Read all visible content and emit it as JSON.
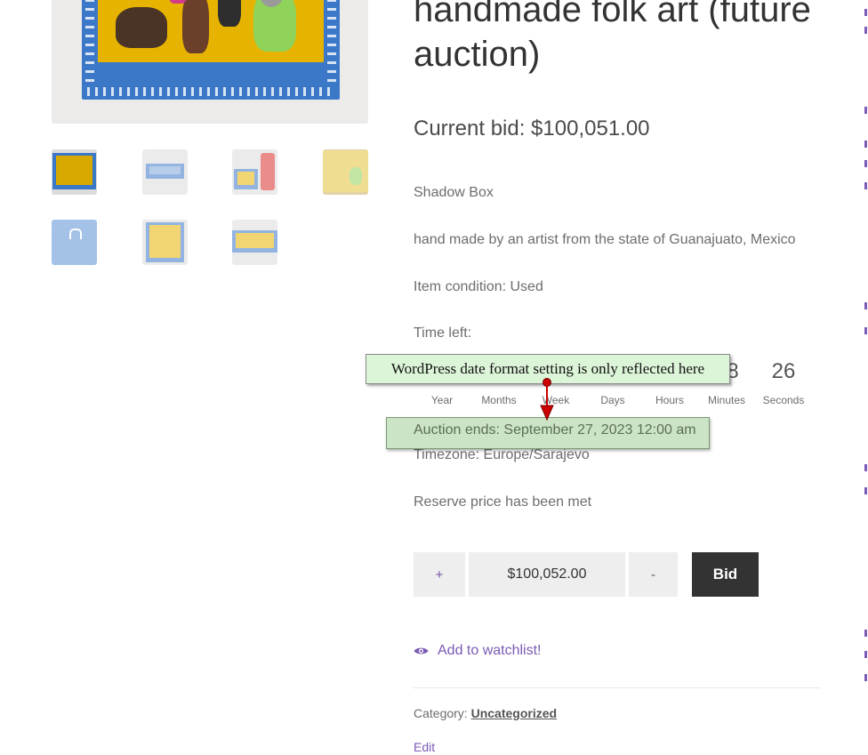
{
  "product": {
    "title": "handmade folk art (future auction)",
    "current_bid": "Current bid: $100,051.00",
    "short_name": "Shadow Box",
    "description": "hand made by an artist from the state of Guanajuato, Mexico",
    "condition": "Item condition: Used",
    "time_left_label": "Time left:"
  },
  "countdown": {
    "units": [
      {
        "label": "Year",
        "value": ""
      },
      {
        "label": "Months",
        "value": ""
      },
      {
        "label": "Week",
        "value": ""
      },
      {
        "label": "Days",
        "value": ""
      },
      {
        "label": "Hours",
        "value": ""
      },
      {
        "label": "Minutes",
        "value": "8"
      },
      {
        "label": "Seconds",
        "value": "26"
      }
    ]
  },
  "annotation": {
    "callout_text": "WordPress date format setting is only reflected here",
    "callout_bg": "#dcf5d8",
    "arrow_color": "#cc0000"
  },
  "auction": {
    "ends": "Auction ends: September 27, 2023 12:00 am",
    "timezone": "Timezone: Europe/Sarajevo",
    "reserve": "Reserve price has been met"
  },
  "bid_form": {
    "plus_label": "+",
    "amount_value": "$100,052.00",
    "minus_label": "-",
    "bid_label": "Bid"
  },
  "watchlist": {
    "icon": "eye-icon",
    "label": "Add to watchlist!"
  },
  "meta": {
    "category_prefix": "Category: ",
    "category_link": "Uncategorized",
    "edit_label": "Edit"
  },
  "colors": {
    "link_purple": "#7b5bb5",
    "bid_button": "#333333",
    "frame_blue": "#3b78c8"
  }
}
